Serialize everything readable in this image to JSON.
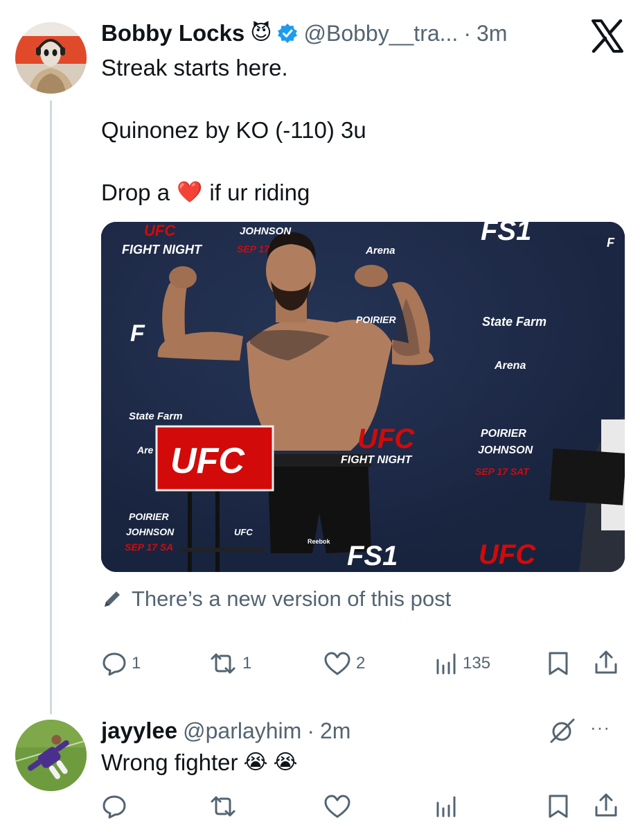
{
  "post": {
    "author_name": "Bobby Locks",
    "author_badge_emoji": "😈",
    "verified": true,
    "handle": "@Bobby__tra...",
    "separator": "·",
    "time": "3m",
    "lines": [
      "Streak starts here.",
      "Quinonez by KO (-110) 3u"
    ],
    "line3_before": "Drop a",
    "line3_emoji": "❤️",
    "line3_after": "if ur riding",
    "media": {
      "backdrop_texts": [
        "UFC",
        "FIGHT NIGHT",
        "JOHNSON",
        "SEP 17",
        "Arena",
        "FS1",
        "F",
        "State Farm",
        "Arena",
        "POIRIER",
        "UFC",
        "FIGHT NIGHT",
        "POIRIER",
        "JOHNSON",
        "SEP 17 SAT",
        "State Farm",
        "Are",
        "POIRIER",
        "JOHNSON",
        "SEP 17 SA",
        "FS1",
        "UFC",
        "F"
      ],
      "sign_text": "UFC",
      "shorts_logo": "UFC",
      "shorts_brand": "Reebok"
    },
    "edit_note": "There’s a new version of this post",
    "metrics": {
      "replies": "1",
      "reposts": "1",
      "likes": "2",
      "views": "135"
    },
    "icons": [
      "pencil-icon",
      "reply-icon",
      "repost-icon",
      "like-icon",
      "views-icon",
      "bookmark-icon",
      "share-icon",
      "x-logo-icon",
      "verified-badge-icon"
    ]
  },
  "reply": {
    "author_name": "jayylee",
    "handle": "@parlayhim",
    "separator": "·",
    "time": "2m",
    "text": "Wrong fighter",
    "emojis": [
      "😭",
      "😭"
    ],
    "more_label": "···",
    "icons": [
      "grok-icon",
      "more-icon",
      "reply-icon",
      "repost-icon",
      "like-icon",
      "views-icon",
      "bookmark-icon",
      "share-icon"
    ]
  },
  "colors": {
    "text": "#0f1419",
    "secondary": "#536471",
    "verified": "#1d9bf0",
    "ufc_red": "#d20a0a",
    "thread_line": "#cfd9de",
    "backdrop": "#1c2742"
  }
}
